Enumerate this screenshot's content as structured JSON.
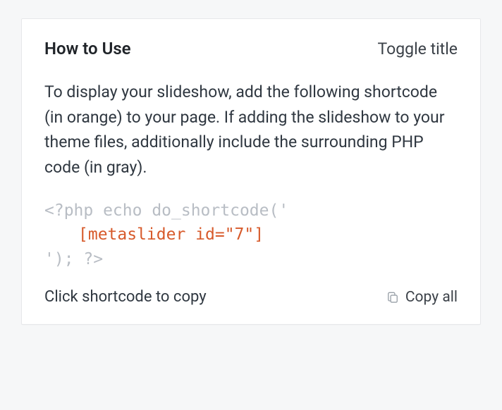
{
  "header": {
    "title": "How to Use",
    "toggle_label": "Toggle title"
  },
  "body": {
    "description": "To display your slideshow, add the following shortcode (in orange) to your page. If adding the slideshow to your theme files, additionally include the surrounding PHP code (in gray).",
    "code": {
      "php_before": "<?php echo do_shortcode('",
      "shortcode": "[metaslider id=\"7\"]",
      "php_after": "'); ?>"
    }
  },
  "footer": {
    "hint": "Click shortcode to copy",
    "copy_all_label": "Copy all"
  }
}
